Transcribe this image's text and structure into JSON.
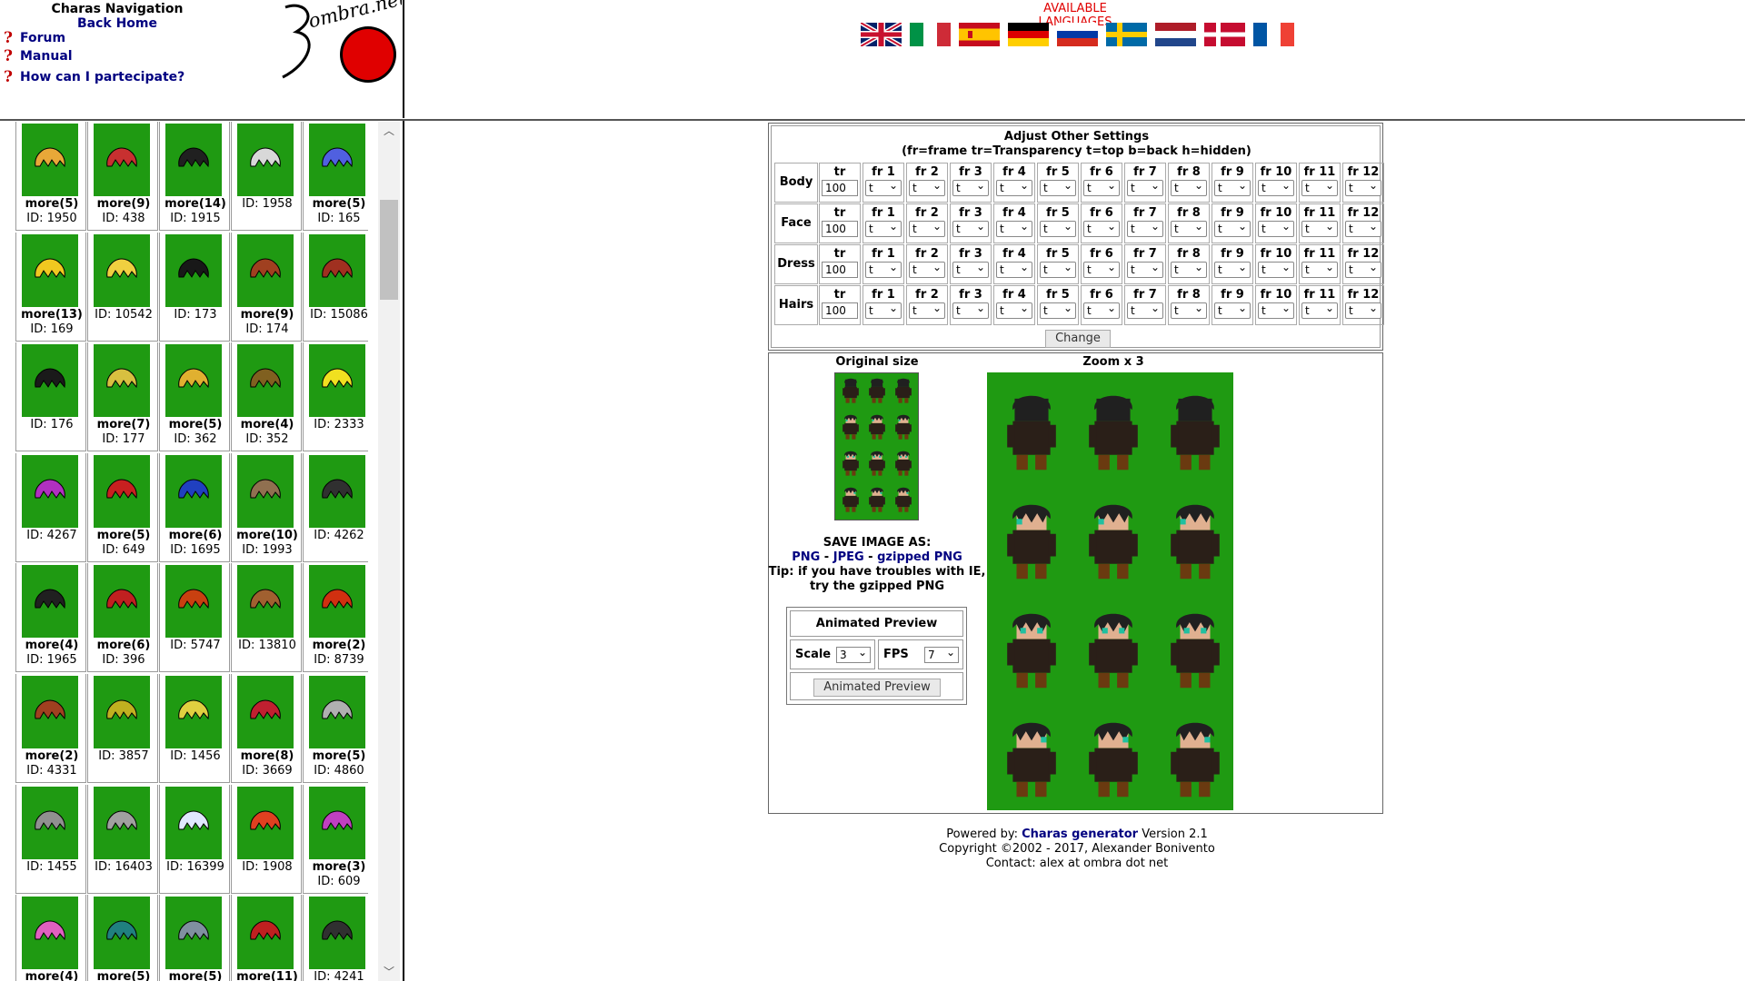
{
  "nav": {
    "title": "Charas Navigation",
    "home": "Back Home",
    "links": [
      "Forum",
      "Manual",
      "How can I partecipate?"
    ],
    "logo_text": "ombra.net"
  },
  "languages": {
    "title": "AVAILABLE LANGUAGES",
    "flags": [
      "english-flag-icon",
      "italian-flag-icon",
      "spanish-flag-icon",
      "german-flag-icon",
      "russian-flag-icon",
      "swedish-flag-icon",
      "dutch-flag-icon",
      "danish-flag-icon",
      "french-flag-icon"
    ]
  },
  "hairs": [
    {
      "more": "more(5)",
      "id": "ID: 1950",
      "color": "#e8a838"
    },
    {
      "more": "more(9)",
      "id": "ID: 438",
      "color": "#c83030"
    },
    {
      "more": "more(14)",
      "id": "ID: 1915",
      "color": "#202020"
    },
    {
      "more": "",
      "id": "ID: 1958",
      "color": "#d8d8d8"
    },
    {
      "more": "more(5)",
      "id": "ID: 165",
      "color": "#5060e0"
    },
    {
      "more": "more(13)",
      "id": "ID: 169",
      "color": "#f0c820"
    },
    {
      "more": "",
      "id": "ID: 10542",
      "color": "#f0d040"
    },
    {
      "more": "",
      "id": "ID: 173",
      "color": "#181818"
    },
    {
      "more": "more(9)",
      "id": "ID: 174",
      "color": "#a04020"
    },
    {
      "more": "",
      "id": "ID: 15086",
      "color": "#a03020"
    },
    {
      "more": "",
      "id": "ID: 176",
      "color": "#1a1a1a"
    },
    {
      "more": "more(7)",
      "id": "ID: 177",
      "color": "#d8c040"
    },
    {
      "more": "more(5)",
      "id": "ID: 362",
      "color": "#e0b030"
    },
    {
      "more": "more(4)",
      "id": "ID: 352",
      "color": "#806020"
    },
    {
      "more": "",
      "id": "ID: 2333",
      "color": "#f0e020"
    },
    {
      "more": "",
      "id": "ID: 4267",
      "color": "#b030c0"
    },
    {
      "more": "more(5)",
      "id": "ID: 649",
      "color": "#c82020"
    },
    {
      "more": "more(6)",
      "id": "ID: 1695",
      "color": "#2040c0"
    },
    {
      "more": "more(10)",
      "id": "ID: 1993",
      "color": "#907050"
    },
    {
      "more": "",
      "id": "ID: 4262",
      "color": "#303030"
    },
    {
      "more": "more(4)",
      "id": "ID: 1965",
      "color": "#202020"
    },
    {
      "more": "more(6)",
      "id": "ID: 396",
      "color": "#c02020"
    },
    {
      "more": "",
      "id": "ID: 5747",
      "color": "#c84010"
    },
    {
      "more": "",
      "id": "ID: 13810",
      "color": "#a06030"
    },
    {
      "more": "more(2)",
      "id": "ID: 8739",
      "color": "#d03010"
    },
    {
      "more": "more(2)",
      "id": "ID: 4331",
      "color": "#a04020"
    },
    {
      "more": "",
      "id": "ID: 3857",
      "color": "#c0b020"
    },
    {
      "more": "",
      "id": "ID: 1456",
      "color": "#e0d040"
    },
    {
      "more": "more(8)",
      "id": "ID: 3669",
      "color": "#c02030"
    },
    {
      "more": "more(5)",
      "id": "ID: 4860",
      "color": "#b0b0b0"
    },
    {
      "more": "",
      "id": "ID: 1455",
      "color": "#909090"
    },
    {
      "more": "",
      "id": "ID: 16403",
      "color": "#a0a0a0"
    },
    {
      "more": "",
      "id": "ID: 16399",
      "color": "#e0e8ff"
    },
    {
      "more": "",
      "id": "ID: 1908",
      "color": "#e04020"
    },
    {
      "more": "more(3)",
      "id": "ID: 609",
      "color": "#c040c0"
    },
    {
      "more": "more(4)",
      "id": "",
      "color": "#e060c0"
    },
    {
      "more": "more(5)",
      "id": "",
      "color": "#208080"
    },
    {
      "more": "more(5)",
      "id": "",
      "color": "#8090a0"
    },
    {
      "more": "more(11)",
      "id": "",
      "color": "#c02020"
    },
    {
      "more": "",
      "id": "ID: 4241",
      "color": "#303030"
    }
  ],
  "settings": {
    "title1": "Adjust Other Settings",
    "title2": "(fr=frame tr=Transparency t=top b=back h=hidden)",
    "tr_label": "tr",
    "frames": [
      "fr 1",
      "fr 2",
      "fr 3",
      "fr 4",
      "fr 5",
      "fr 6",
      "fr 7",
      "fr 8",
      "fr 9",
      "fr 10",
      "fr 11",
      "fr 12"
    ],
    "rows": [
      {
        "label": "Body",
        "tr": "100",
        "value": "t"
      },
      {
        "label": "Face",
        "tr": "100",
        "value": "t"
      },
      {
        "label": "Dress",
        "tr": "100",
        "value": "t"
      },
      {
        "label": "Hairs",
        "tr": "100",
        "value": "t"
      }
    ],
    "change_label": "Change"
  },
  "preview": {
    "original_label": "Original size",
    "zoom_label": "Zoom x 3",
    "save_title": "SAVE IMAGE AS:",
    "save_png": "PNG",
    "save_sep1": " - ",
    "save_jpeg": "JPEG",
    "save_sep2": " - ",
    "save_gz": "gzipped PNG",
    "tip1": "Tip: if you have troubles with IE,",
    "tip2": "try the gzipped PNG",
    "anim_title": "Animated Preview",
    "scale_label": "Scale",
    "scale_value": "3",
    "fps_label": "FPS",
    "fps_value": "7",
    "anim_button": "Animated Preview"
  },
  "footer": {
    "powered_prefix": "Powered by: ",
    "powered_link": "Charas generator",
    "powered_suffix": " Version 2.1",
    "copyright": "Copyright ©2002 - 2017, Alexander Bonivento",
    "contact": "Contact: alex at ombra dot net"
  }
}
